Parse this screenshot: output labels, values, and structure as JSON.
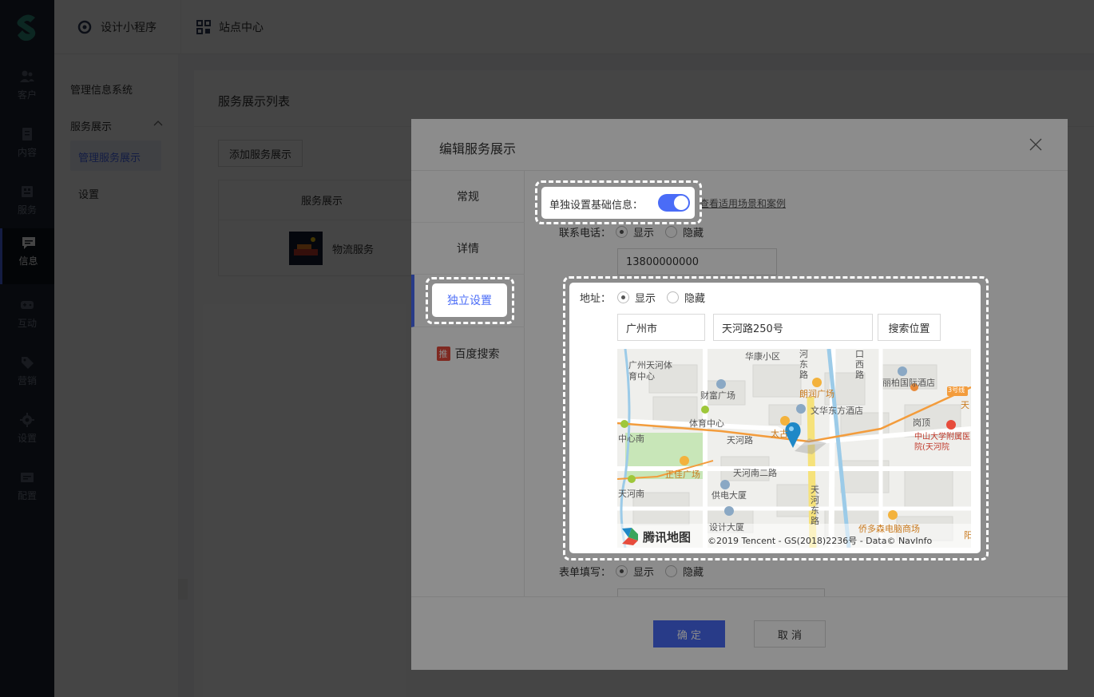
{
  "nav": {
    "items": [
      {
        "label": "客户"
      },
      {
        "label": "内容"
      },
      {
        "label": "服务"
      },
      {
        "label": "信息"
      },
      {
        "label": "互动"
      },
      {
        "label": "营销"
      },
      {
        "label": "设置"
      },
      {
        "label": "配置"
      }
    ],
    "active_index": 3
  },
  "topbar": {
    "design_label": "设计小程序",
    "site_label": "站点中心"
  },
  "subnav": {
    "section_title": "管理信息系统",
    "group_label": "服务展示",
    "active_item": "管理服务展示",
    "settings_item": "设置"
  },
  "main": {
    "page_title": "服务展示列表",
    "add_button": "添加服务展示",
    "table_header": "服务展示",
    "row_name": "物流服务"
  },
  "modal": {
    "title": "编辑服务展示",
    "tabs": [
      "常规",
      "详情",
      "独立设置",
      "百度搜索"
    ],
    "active_tab": 2,
    "baidu_badge": "推",
    "switch_label": "单独设置基础信息：",
    "switch_on": true,
    "help_link": "查看适用场景和案例",
    "phone_label": "联系电话：",
    "show": "显示",
    "hide": "隐藏",
    "phone_value": "13800000000",
    "address_label": "地址：",
    "city_value": "广州市",
    "street_value": "天河路250号",
    "search_button": "搜索位置",
    "form_label": "表单填写：",
    "ok_button": "确 定",
    "cancel_button": "取 消"
  },
  "map": {
    "labels": [
      "广州天河体育中心",
      "华康小区",
      "河东路",
      "口西路",
      "丽柏国际酒店",
      "朗润广场",
      "财富广场",
      "文华东方酒店",
      "3号线",
      "天",
      "体育中心",
      "岗顶",
      "中山大学附属医院(天河院",
      "中心南",
      "天河路",
      "太古",
      "天河南二路",
      "正佳广场",
      "天河南",
      "供电大厦",
      "天河东路",
      "设计大厦",
      "侨多森电脑商场",
      "阳"
    ],
    "brand": "腾讯地图",
    "copyright": "©2019 Tencent - GS(2018)2236号 - Data© NavInfo"
  },
  "colors": {
    "accent": "#4a6cf7",
    "nav_bg": "#1c2532",
    "ok_button": "#4a6cf7",
    "road_orange": "#f39c3c"
  }
}
